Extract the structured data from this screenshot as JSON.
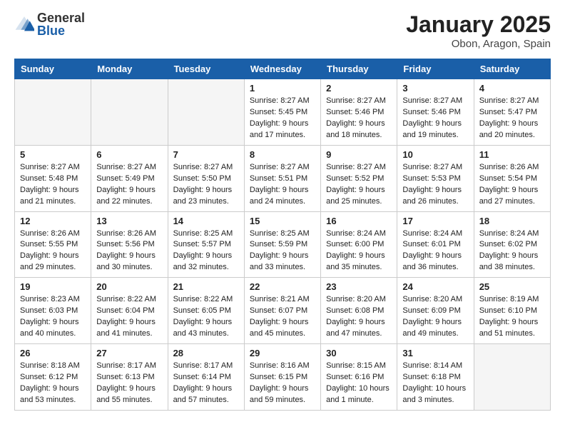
{
  "logo": {
    "general": "General",
    "blue": "Blue"
  },
  "title": "January 2025",
  "subtitle": "Obon, Aragon, Spain",
  "weekdays": [
    "Sunday",
    "Monday",
    "Tuesday",
    "Wednesday",
    "Thursday",
    "Friday",
    "Saturday"
  ],
  "weeks": [
    [
      {
        "num": "",
        "empty": true
      },
      {
        "num": "",
        "empty": true
      },
      {
        "num": "",
        "empty": true
      },
      {
        "num": "1",
        "sunrise": "8:27 AM",
        "sunset": "5:45 PM",
        "daylight": "9 hours and 17 minutes."
      },
      {
        "num": "2",
        "sunrise": "8:27 AM",
        "sunset": "5:46 PM",
        "daylight": "9 hours and 18 minutes."
      },
      {
        "num": "3",
        "sunrise": "8:27 AM",
        "sunset": "5:46 PM",
        "daylight": "9 hours and 19 minutes."
      },
      {
        "num": "4",
        "sunrise": "8:27 AM",
        "sunset": "5:47 PM",
        "daylight": "9 hours and 20 minutes."
      }
    ],
    [
      {
        "num": "5",
        "sunrise": "8:27 AM",
        "sunset": "5:48 PM",
        "daylight": "9 hours and 21 minutes."
      },
      {
        "num": "6",
        "sunrise": "8:27 AM",
        "sunset": "5:49 PM",
        "daylight": "9 hours and 22 minutes."
      },
      {
        "num": "7",
        "sunrise": "8:27 AM",
        "sunset": "5:50 PM",
        "daylight": "9 hours and 23 minutes."
      },
      {
        "num": "8",
        "sunrise": "8:27 AM",
        "sunset": "5:51 PM",
        "daylight": "9 hours and 24 minutes."
      },
      {
        "num": "9",
        "sunrise": "8:27 AM",
        "sunset": "5:52 PM",
        "daylight": "9 hours and 25 minutes."
      },
      {
        "num": "10",
        "sunrise": "8:27 AM",
        "sunset": "5:53 PM",
        "daylight": "9 hours and 26 minutes."
      },
      {
        "num": "11",
        "sunrise": "8:26 AM",
        "sunset": "5:54 PM",
        "daylight": "9 hours and 27 minutes."
      }
    ],
    [
      {
        "num": "12",
        "sunrise": "8:26 AM",
        "sunset": "5:55 PM",
        "daylight": "9 hours and 29 minutes."
      },
      {
        "num": "13",
        "sunrise": "8:26 AM",
        "sunset": "5:56 PM",
        "daylight": "9 hours and 30 minutes."
      },
      {
        "num": "14",
        "sunrise": "8:25 AM",
        "sunset": "5:57 PM",
        "daylight": "9 hours and 32 minutes."
      },
      {
        "num": "15",
        "sunrise": "8:25 AM",
        "sunset": "5:59 PM",
        "daylight": "9 hours and 33 minutes."
      },
      {
        "num": "16",
        "sunrise": "8:24 AM",
        "sunset": "6:00 PM",
        "daylight": "9 hours and 35 minutes."
      },
      {
        "num": "17",
        "sunrise": "8:24 AM",
        "sunset": "6:01 PM",
        "daylight": "9 hours and 36 minutes."
      },
      {
        "num": "18",
        "sunrise": "8:24 AM",
        "sunset": "6:02 PM",
        "daylight": "9 hours and 38 minutes."
      }
    ],
    [
      {
        "num": "19",
        "sunrise": "8:23 AM",
        "sunset": "6:03 PM",
        "daylight": "9 hours and 40 minutes."
      },
      {
        "num": "20",
        "sunrise": "8:22 AM",
        "sunset": "6:04 PM",
        "daylight": "9 hours and 41 minutes."
      },
      {
        "num": "21",
        "sunrise": "8:22 AM",
        "sunset": "6:05 PM",
        "daylight": "9 hours and 43 minutes."
      },
      {
        "num": "22",
        "sunrise": "8:21 AM",
        "sunset": "6:07 PM",
        "daylight": "9 hours and 45 minutes."
      },
      {
        "num": "23",
        "sunrise": "8:20 AM",
        "sunset": "6:08 PM",
        "daylight": "9 hours and 47 minutes."
      },
      {
        "num": "24",
        "sunrise": "8:20 AM",
        "sunset": "6:09 PM",
        "daylight": "9 hours and 49 minutes."
      },
      {
        "num": "25",
        "sunrise": "8:19 AM",
        "sunset": "6:10 PM",
        "daylight": "9 hours and 51 minutes."
      }
    ],
    [
      {
        "num": "26",
        "sunrise": "8:18 AM",
        "sunset": "6:12 PM",
        "daylight": "9 hours and 53 minutes."
      },
      {
        "num": "27",
        "sunrise": "8:17 AM",
        "sunset": "6:13 PM",
        "daylight": "9 hours and 55 minutes."
      },
      {
        "num": "28",
        "sunrise": "8:17 AM",
        "sunset": "6:14 PM",
        "daylight": "9 hours and 57 minutes."
      },
      {
        "num": "29",
        "sunrise": "8:16 AM",
        "sunset": "6:15 PM",
        "daylight": "9 hours and 59 minutes."
      },
      {
        "num": "30",
        "sunrise": "8:15 AM",
        "sunset": "6:16 PM",
        "daylight": "10 hours and 1 minute."
      },
      {
        "num": "31",
        "sunrise": "8:14 AM",
        "sunset": "6:18 PM",
        "daylight": "10 hours and 3 minutes."
      },
      {
        "num": "",
        "empty": true
      }
    ]
  ]
}
